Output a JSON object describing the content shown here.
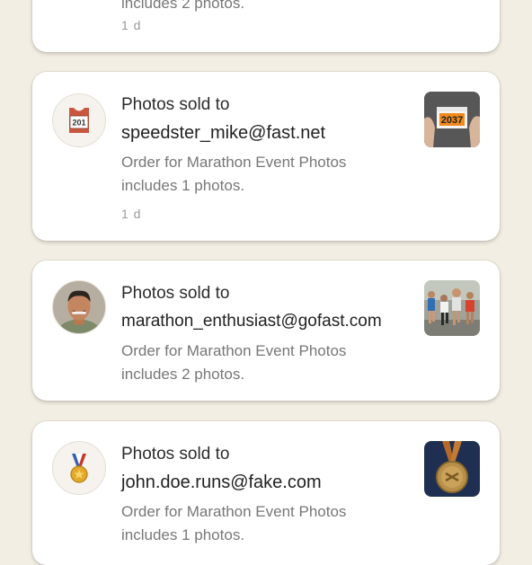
{
  "notifications": [
    {
      "desc_line2": "includes 2 photos.",
      "time": "1 d",
      "avatar_icon": "collapsed",
      "thumbnail_icon": "none"
    },
    {
      "title": "Photos sold to",
      "email": "speedster_mike@fast.net",
      "desc_line1": "Order for Marathon Event Photos",
      "desc_line2": "includes 1 photos.",
      "time": "1 d",
      "avatar_icon": "race-bib-icon",
      "avatar_bib_number": "201",
      "thumbnail_icon": "runner-bib-photo",
      "thumbnail_bib_number": "2037"
    },
    {
      "title": "Photos sold to",
      "email": "marathon_enthusiast@gofast.com",
      "desc_line1": "Order for Marathon Event Photos",
      "desc_line2": "includes 2 photos.",
      "avatar_icon": "runner-portrait",
      "thumbnail_icon": "marathon-runners-photo"
    },
    {
      "title": "Photos sold to",
      "email": "john.doe.runs@fake.com",
      "desc_line1": "Order for Marathon Event Photos",
      "desc_line2": "includes 1 photos.",
      "avatar_icon": "medal-icon",
      "thumbnail_icon": "finisher-medal-photo"
    }
  ]
}
